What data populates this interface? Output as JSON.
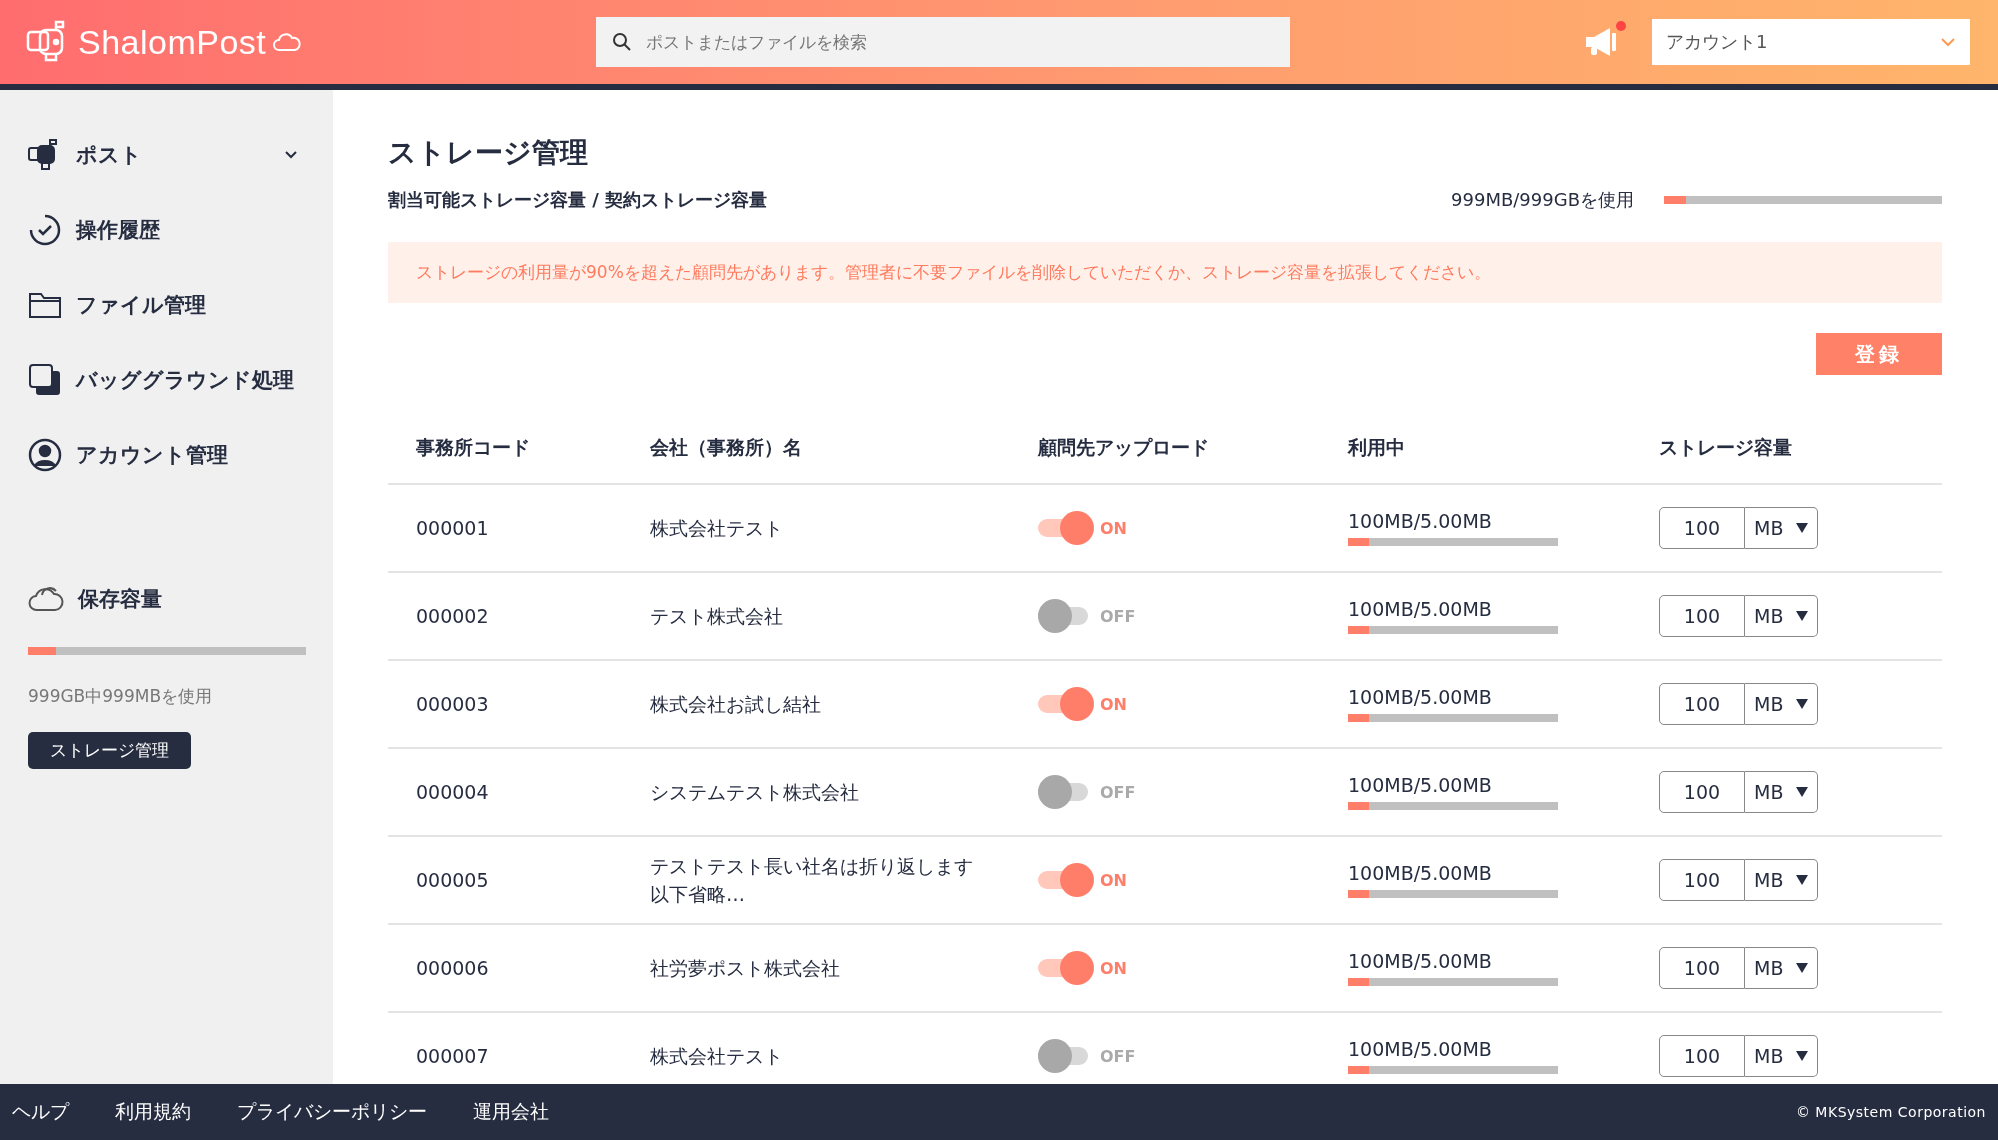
{
  "header": {
    "logo": "ShalomPost",
    "search": {
      "placeholder": "ポストまたはファイルを検索"
    },
    "notifications": {
      "unread": true
    },
    "account": {
      "value": "アカウント1"
    }
  },
  "sidebar": {
    "items": [
      {
        "label": "ポスト",
        "kind": "dropdown"
      },
      {
        "label": "操作履歴",
        "kind": "link"
      },
      {
        "label": "ファイル管理",
        "kind": "link"
      },
      {
        "label": "バッググラウンド処理",
        "kind": "link"
      },
      {
        "label": "アカウント管理",
        "kind": "link"
      }
    ],
    "storage": {
      "title": "保存容量",
      "level": 0.1,
      "text": "999GB中999MBを使用",
      "button": "ストレージ管理"
    }
  },
  "page": {
    "title": "ストレージ管理",
    "subtitle": "割当可能ストレージ容量 / 契約ストレージ容量",
    "usage": {
      "text": "999MB/999GBを使用",
      "level": 0.08
    },
    "alert": "ストレージの利用量が90%を超えた顧問先があります。管理者に不要ファイルを削除していただくか、ストレージ容量を拡張してください。",
    "register_button": "登録"
  },
  "table": {
    "columns": [
      "事務所コード",
      "会社（事務所）名",
      "顧問先アップロード",
      "利用中",
      "ストレージ容量"
    ],
    "rows": [
      {
        "code": "000001",
        "name": "株式会社テスト",
        "upload_on": true,
        "toggle_label": "ON",
        "usage": "100MB/5.00MB",
        "level": 0.1,
        "capacity": "100",
        "unit": "MB"
      },
      {
        "code": "000002",
        "name": "テスト株式会社",
        "upload_on": false,
        "toggle_label": "OFF",
        "usage": "100MB/5.00MB",
        "level": 0.1,
        "capacity": "100",
        "unit": "MB"
      },
      {
        "code": "000003",
        "name": "株式会社お試し結社",
        "upload_on": true,
        "toggle_label": "ON",
        "usage": "100MB/5.00MB",
        "level": 0.1,
        "capacity": "100",
        "unit": "MB"
      },
      {
        "code": "000004",
        "name": "システムテスト株式会社",
        "upload_on": false,
        "toggle_label": "OFF",
        "usage": "100MB/5.00MB",
        "level": 0.1,
        "capacity": "100",
        "unit": "MB"
      },
      {
        "code": "000005",
        "name": "テストテスト長い社名は折り返します以下省略…",
        "upload_on": true,
        "toggle_label": "ON",
        "usage": "100MB/5.00MB",
        "level": 0.1,
        "capacity": "100",
        "unit": "MB"
      },
      {
        "code": "000006",
        "name": "社労夢ポスト株式会社",
        "upload_on": true,
        "toggle_label": "ON",
        "usage": "100MB/5.00MB",
        "level": 0.1,
        "capacity": "100",
        "unit": "MB"
      },
      {
        "code": "000007",
        "name": "株式会社テスト",
        "upload_on": false,
        "toggle_label": "OFF",
        "usage": "100MB/5.00MB",
        "level": 0.1,
        "capacity": "100",
        "unit": "MB"
      }
    ]
  },
  "footer": {
    "links": [
      "ヘルプ",
      "利用規約",
      "プライバシーポリシー",
      "運用会社"
    ],
    "copyright": "© MKSystem Corporation"
  }
}
